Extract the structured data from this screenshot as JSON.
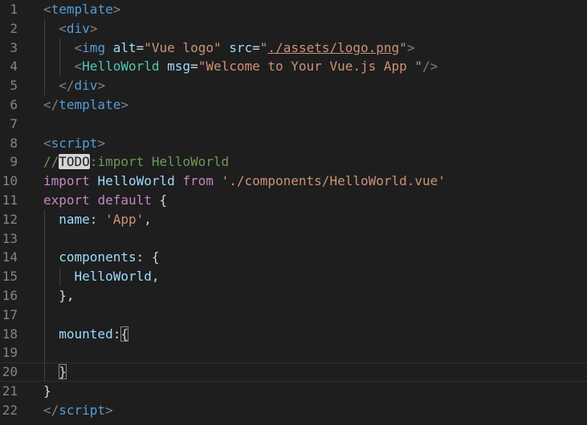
{
  "editor": {
    "lines": [
      {
        "n": "1",
        "tokens": [
          {
            "t": "<",
            "c": "punc"
          },
          {
            "t": "template",
            "c": "tag"
          },
          {
            "t": ">",
            "c": "punc"
          }
        ]
      },
      {
        "n": "2",
        "tokens": [
          {
            "t": "  ",
            "c": "txt"
          },
          {
            "t": "<",
            "c": "punc"
          },
          {
            "t": "div",
            "c": "tag"
          },
          {
            "t": ">",
            "c": "punc"
          }
        ]
      },
      {
        "n": "3",
        "tokens": [
          {
            "t": "    ",
            "c": "txt"
          },
          {
            "t": "<",
            "c": "punc"
          },
          {
            "t": "img",
            "c": "tag"
          },
          {
            "t": " ",
            "c": "txt"
          },
          {
            "t": "alt",
            "c": "attr"
          },
          {
            "t": "=",
            "c": "txt"
          },
          {
            "t": "\"Vue logo\"",
            "c": "str"
          },
          {
            "t": " ",
            "c": "txt"
          },
          {
            "t": "src",
            "c": "attr"
          },
          {
            "t": "=",
            "c": "txt"
          },
          {
            "t": "\"",
            "c": "str"
          },
          {
            "t": "./assets/logo.png",
            "c": "str",
            "u": true
          },
          {
            "t": "\"",
            "c": "str"
          },
          {
            "t": ">",
            "c": "punc"
          }
        ]
      },
      {
        "n": "4",
        "tokens": [
          {
            "t": "    ",
            "c": "txt"
          },
          {
            "t": "<",
            "c": "punc"
          },
          {
            "t": "HelloWorld",
            "c": "comp"
          },
          {
            "t": " ",
            "c": "txt"
          },
          {
            "t": "msg",
            "c": "attr"
          },
          {
            "t": "=",
            "c": "txt"
          },
          {
            "t": "\"Welcome to Your Vue.js App \"",
            "c": "str"
          },
          {
            "t": "/>",
            "c": "punc"
          }
        ]
      },
      {
        "n": "5",
        "tokens": [
          {
            "t": "  ",
            "c": "txt"
          },
          {
            "t": "</",
            "c": "punc"
          },
          {
            "t": "div",
            "c": "tag"
          },
          {
            "t": ">",
            "c": "punc"
          }
        ]
      },
      {
        "n": "6",
        "tokens": [
          {
            "t": "</",
            "c": "punc"
          },
          {
            "t": "template",
            "c": "tag"
          },
          {
            "t": ">",
            "c": "punc"
          }
        ]
      },
      {
        "n": "7",
        "tokens": []
      },
      {
        "n": "8",
        "tokens": [
          {
            "t": "<",
            "c": "punc"
          },
          {
            "t": "script",
            "c": "tag"
          },
          {
            "t": ">",
            "c": "punc"
          }
        ]
      },
      {
        "n": "9",
        "tokens": [
          {
            "t": "//",
            "c": "com"
          },
          {
            "t": "TODO",
            "c": "todo"
          },
          {
            "t": ":import HelloWorld",
            "c": "com"
          }
        ]
      },
      {
        "n": "10",
        "tokens": [
          {
            "t": "import",
            "c": "kw"
          },
          {
            "t": " ",
            "c": "txt"
          },
          {
            "t": "HelloWorld",
            "c": "var"
          },
          {
            "t": " ",
            "c": "txt"
          },
          {
            "t": "from",
            "c": "kw"
          },
          {
            "t": " ",
            "c": "txt"
          },
          {
            "t": "'./components/HelloWorld.vue'",
            "c": "str"
          }
        ]
      },
      {
        "n": "11",
        "tokens": [
          {
            "t": "export",
            "c": "kw"
          },
          {
            "t": " ",
            "c": "txt"
          },
          {
            "t": "default",
            "c": "kw"
          },
          {
            "t": " {",
            "c": "txt"
          }
        ]
      },
      {
        "n": "12",
        "tokens": [
          {
            "t": "  ",
            "c": "txt"
          },
          {
            "t": "name",
            "c": "var"
          },
          {
            "t": ": ",
            "c": "txt"
          },
          {
            "t": "'App'",
            "c": "str"
          },
          {
            "t": ",",
            "c": "txt"
          }
        ]
      },
      {
        "n": "13",
        "tokens": []
      },
      {
        "n": "14",
        "tokens": [
          {
            "t": "  ",
            "c": "txt"
          },
          {
            "t": "components",
            "c": "var"
          },
          {
            "t": ": {",
            "c": "txt"
          }
        ]
      },
      {
        "n": "15",
        "tokens": [
          {
            "t": "    ",
            "c": "txt"
          },
          {
            "t": "HelloWorld",
            "c": "var"
          },
          {
            "t": ",",
            "c": "txt"
          }
        ]
      },
      {
        "n": "16",
        "tokens": [
          {
            "t": "  },",
            "c": "txt"
          }
        ]
      },
      {
        "n": "17",
        "tokens": []
      },
      {
        "n": "18",
        "tokens": [
          {
            "t": "  ",
            "c": "txt"
          },
          {
            "t": "mounted",
            "c": "var"
          },
          {
            "t": ":",
            "c": "txt"
          },
          {
            "t": "{",
            "c": "txt",
            "box": true
          }
        ]
      },
      {
        "n": "19",
        "tokens": []
      },
      {
        "n": "20",
        "tokens": [
          {
            "t": "  ",
            "c": "txt"
          },
          {
            "t": "}",
            "c": "txt",
            "box": true
          }
        ],
        "current": true
      },
      {
        "n": "21",
        "tokens": [
          {
            "t": "}",
            "c": "txt"
          }
        ]
      },
      {
        "n": "22",
        "tokens": [
          {
            "t": "</",
            "c": "punc"
          },
          {
            "t": "script",
            "c": "tag"
          },
          {
            "t": ">",
            "c": "punc"
          }
        ]
      }
    ]
  }
}
